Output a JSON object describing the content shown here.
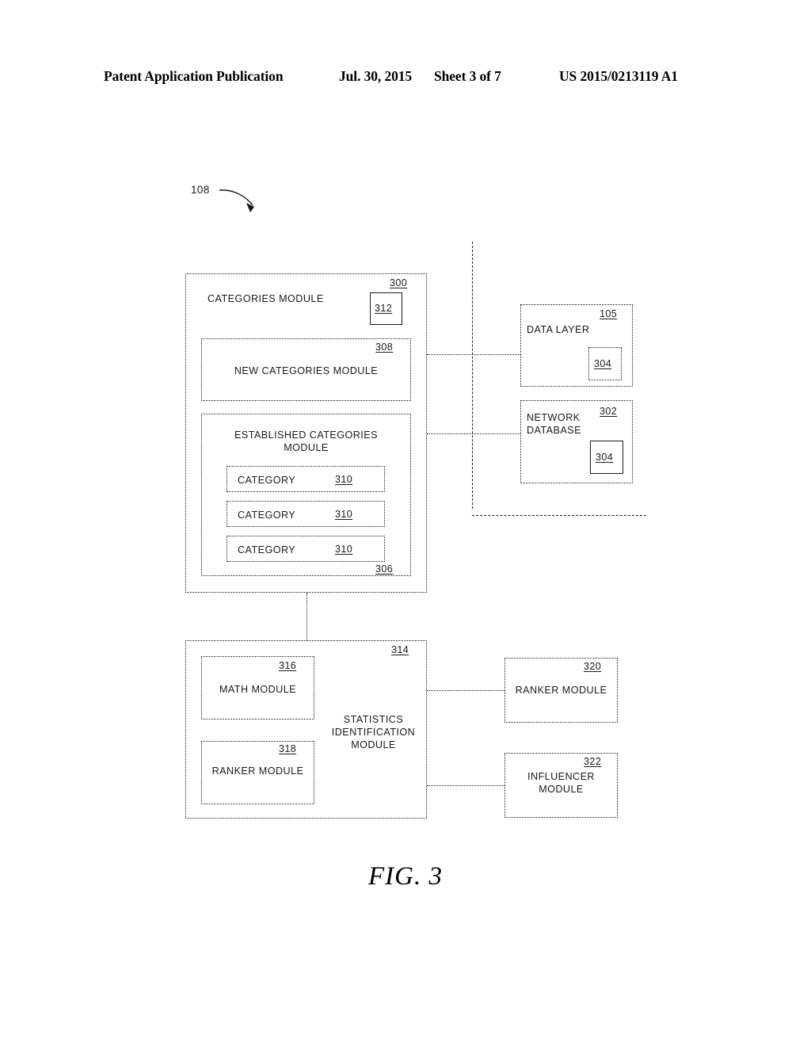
{
  "header": {
    "publication": "Patent Application Publication",
    "date": "Jul. 30, 2015",
    "sheet": "Sheet 3 of 7",
    "patent_number": "US 2015/0213119 A1"
  },
  "figure": {
    "caption": "FIG. 3",
    "lead_reference": "108"
  },
  "diagram": {
    "categories_module": {
      "label": "CATEGORIES MODULE",
      "ref": "300",
      "inner_ref_box": "312",
      "new_categories_module": {
        "label": "NEW CATEGORIES MODULE",
        "ref": "308"
      },
      "established_categories_module": {
        "label": "ESTABLISHED CATEGORIES\nMODULE",
        "ref": "306",
        "categories": [
          {
            "label": "CATEGORY",
            "ref": "310"
          },
          {
            "label": "CATEGORY",
            "ref": "310"
          },
          {
            "label": "CATEGORY",
            "ref": "310"
          }
        ]
      }
    },
    "data_layer": {
      "label": "DATA LAYER",
      "ref": "105",
      "inner_ref_box": "304"
    },
    "network_database": {
      "label": "NETWORK\nDATABASE",
      "ref": "302",
      "inner_ref_box": "304"
    },
    "statistics_identification_module": {
      "label": "STATISTICS\nIDENTIFICATION\nMODULE",
      "ref": "314",
      "math_module": {
        "label": "MATH MODULE",
        "ref": "316"
      },
      "ranker_module": {
        "label": "RANKER MODULE",
        "ref": "318"
      }
    },
    "ranker_module_external": {
      "label": "RANKER MODULE",
      "ref": "320"
    },
    "influencer_module": {
      "label": "INFLUENCER\nMODULE",
      "ref": "322"
    }
  }
}
